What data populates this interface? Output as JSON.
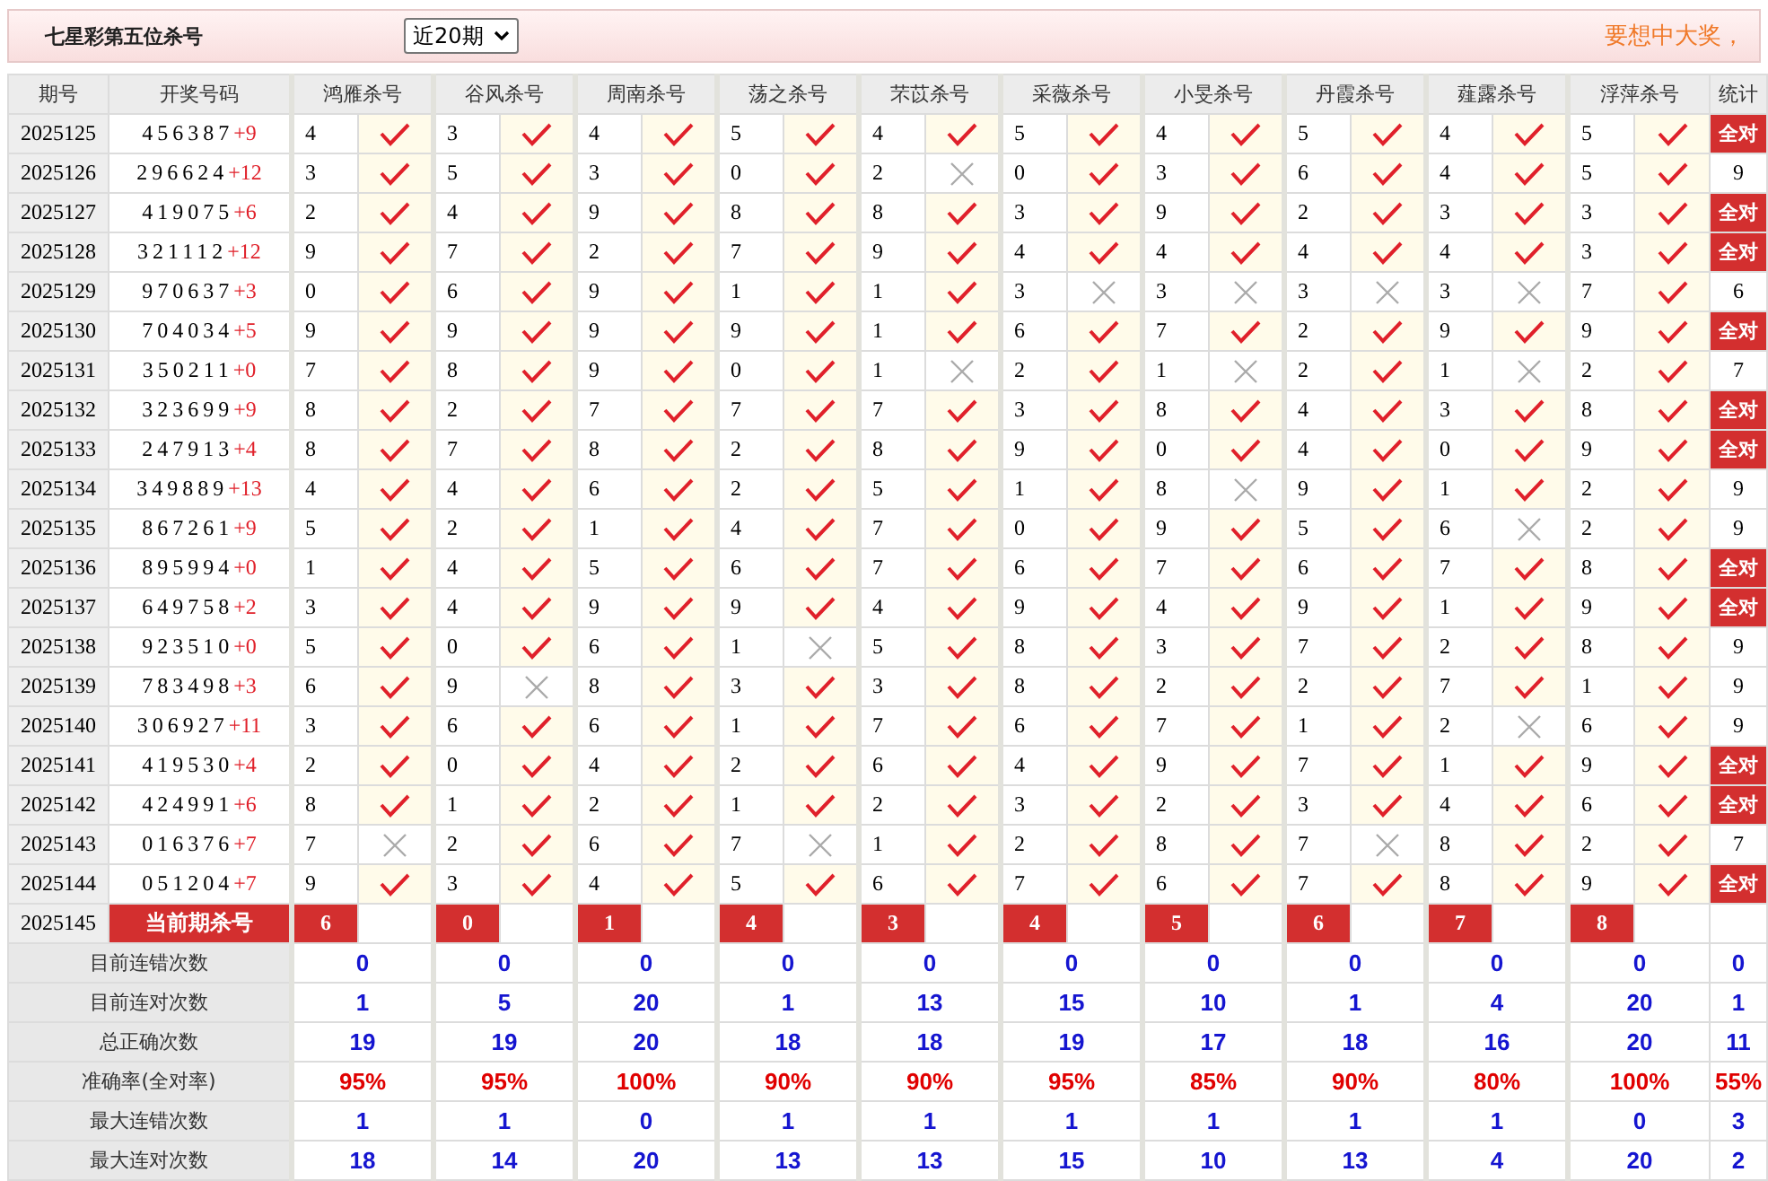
{
  "header": {
    "title": "七星彩第五位杀号",
    "period_select": "近20期",
    "slogan": "要想中大奖，"
  },
  "table": {
    "columns": [
      "期号",
      "开奖号码",
      "鸿雁杀号",
      "谷风杀号",
      "周南杀号",
      "荡之杀号",
      "芣苡杀号",
      "采薇杀号",
      "小旻杀号",
      "丹霞杀号",
      "薤露杀号",
      "浮萍杀号",
      "统计"
    ],
    "rows": [
      {
        "issue": "2025125",
        "draw": "456387",
        "extra": "+9",
        "picks": [
          {
            "number": "4",
            "hit": true
          },
          {
            "number": "3",
            "hit": true
          },
          {
            "number": "4",
            "hit": true
          },
          {
            "number": "5",
            "hit": true
          },
          {
            "number": "4",
            "hit": true
          },
          {
            "number": "5",
            "hit": true
          },
          {
            "number": "4",
            "hit": true
          },
          {
            "number": "5",
            "hit": true
          },
          {
            "number": "4",
            "hit": true
          },
          {
            "number": "5",
            "hit": true
          }
        ],
        "stat": {
          "kind": "badge",
          "text": "全对"
        }
      },
      {
        "issue": "2025126",
        "draw": "296624",
        "extra": "+12",
        "picks": [
          {
            "number": "3",
            "hit": true
          },
          {
            "number": "5",
            "hit": true
          },
          {
            "number": "3",
            "hit": true
          },
          {
            "number": "0",
            "hit": true
          },
          {
            "number": "2",
            "hit": false
          },
          {
            "number": "0",
            "hit": true
          },
          {
            "number": "3",
            "hit": true
          },
          {
            "number": "6",
            "hit": true
          },
          {
            "number": "4",
            "hit": true
          },
          {
            "number": "5",
            "hit": true
          }
        ],
        "stat": {
          "kind": "plain",
          "text": "9"
        }
      },
      {
        "issue": "2025127",
        "draw": "419075",
        "extra": "+6",
        "picks": [
          {
            "number": "2",
            "hit": true
          },
          {
            "number": "4",
            "hit": true
          },
          {
            "number": "9",
            "hit": true
          },
          {
            "number": "8",
            "hit": true
          },
          {
            "number": "8",
            "hit": true
          },
          {
            "number": "3",
            "hit": true
          },
          {
            "number": "9",
            "hit": true
          },
          {
            "number": "2",
            "hit": true
          },
          {
            "number": "3",
            "hit": true
          },
          {
            "number": "3",
            "hit": true
          }
        ],
        "stat": {
          "kind": "badge",
          "text": "全对"
        }
      },
      {
        "issue": "2025128",
        "draw": "321112",
        "extra": "+12",
        "picks": [
          {
            "number": "9",
            "hit": true
          },
          {
            "number": "7",
            "hit": true
          },
          {
            "number": "2",
            "hit": true
          },
          {
            "number": "7",
            "hit": true
          },
          {
            "number": "9",
            "hit": true
          },
          {
            "number": "4",
            "hit": true
          },
          {
            "number": "4",
            "hit": true
          },
          {
            "number": "4",
            "hit": true
          },
          {
            "number": "4",
            "hit": true
          },
          {
            "number": "3",
            "hit": true
          }
        ],
        "stat": {
          "kind": "badge",
          "text": "全对"
        }
      },
      {
        "issue": "2025129",
        "draw": "970637",
        "extra": "+3",
        "picks": [
          {
            "number": "0",
            "hit": true
          },
          {
            "number": "6",
            "hit": true
          },
          {
            "number": "9",
            "hit": true
          },
          {
            "number": "1",
            "hit": true
          },
          {
            "number": "1",
            "hit": true
          },
          {
            "number": "3",
            "hit": false
          },
          {
            "number": "3",
            "hit": false
          },
          {
            "number": "3",
            "hit": false
          },
          {
            "number": "3",
            "hit": false
          },
          {
            "number": "7",
            "hit": true
          }
        ],
        "stat": {
          "kind": "plain",
          "text": "6"
        }
      },
      {
        "issue": "2025130",
        "draw": "704034",
        "extra": "+5",
        "picks": [
          {
            "number": "9",
            "hit": true
          },
          {
            "number": "9",
            "hit": true
          },
          {
            "number": "9",
            "hit": true
          },
          {
            "number": "9",
            "hit": true
          },
          {
            "number": "1",
            "hit": true
          },
          {
            "number": "6",
            "hit": true
          },
          {
            "number": "7",
            "hit": true
          },
          {
            "number": "2",
            "hit": true
          },
          {
            "number": "9",
            "hit": true
          },
          {
            "number": "9",
            "hit": true
          }
        ],
        "stat": {
          "kind": "badge",
          "text": "全对"
        }
      },
      {
        "issue": "2025131",
        "draw": "350211",
        "extra": "+0",
        "picks": [
          {
            "number": "7",
            "hit": true
          },
          {
            "number": "8",
            "hit": true
          },
          {
            "number": "9",
            "hit": true
          },
          {
            "number": "0",
            "hit": true
          },
          {
            "number": "1",
            "hit": false
          },
          {
            "number": "2",
            "hit": true
          },
          {
            "number": "1",
            "hit": false
          },
          {
            "number": "2",
            "hit": true
          },
          {
            "number": "1",
            "hit": false
          },
          {
            "number": "2",
            "hit": true
          }
        ],
        "stat": {
          "kind": "plain",
          "text": "7"
        }
      },
      {
        "issue": "2025132",
        "draw": "323699",
        "extra": "+9",
        "picks": [
          {
            "number": "8",
            "hit": true
          },
          {
            "number": "2",
            "hit": true
          },
          {
            "number": "7",
            "hit": true
          },
          {
            "number": "7",
            "hit": true
          },
          {
            "number": "7",
            "hit": true
          },
          {
            "number": "3",
            "hit": true
          },
          {
            "number": "8",
            "hit": true
          },
          {
            "number": "4",
            "hit": true
          },
          {
            "number": "3",
            "hit": true
          },
          {
            "number": "8",
            "hit": true
          }
        ],
        "stat": {
          "kind": "badge",
          "text": "全对"
        }
      },
      {
        "issue": "2025133",
        "draw": "247913",
        "extra": "+4",
        "picks": [
          {
            "number": "8",
            "hit": true
          },
          {
            "number": "7",
            "hit": true
          },
          {
            "number": "8",
            "hit": true
          },
          {
            "number": "2",
            "hit": true
          },
          {
            "number": "8",
            "hit": true
          },
          {
            "number": "9",
            "hit": true
          },
          {
            "number": "0",
            "hit": true
          },
          {
            "number": "4",
            "hit": true
          },
          {
            "number": "0",
            "hit": true
          },
          {
            "number": "9",
            "hit": true
          }
        ],
        "stat": {
          "kind": "badge",
          "text": "全对"
        }
      },
      {
        "issue": "2025134",
        "draw": "349889",
        "extra": "+13",
        "picks": [
          {
            "number": "4",
            "hit": true
          },
          {
            "number": "4",
            "hit": true
          },
          {
            "number": "6",
            "hit": true
          },
          {
            "number": "2",
            "hit": true
          },
          {
            "number": "5",
            "hit": true
          },
          {
            "number": "1",
            "hit": true
          },
          {
            "number": "8",
            "hit": false
          },
          {
            "number": "9",
            "hit": true
          },
          {
            "number": "1",
            "hit": true
          },
          {
            "number": "2",
            "hit": true
          }
        ],
        "stat": {
          "kind": "plain",
          "text": "9"
        }
      },
      {
        "issue": "2025135",
        "draw": "867261",
        "extra": "+9",
        "picks": [
          {
            "number": "5",
            "hit": true
          },
          {
            "number": "2",
            "hit": true
          },
          {
            "number": "1",
            "hit": true
          },
          {
            "number": "4",
            "hit": true
          },
          {
            "number": "7",
            "hit": true
          },
          {
            "number": "0",
            "hit": true
          },
          {
            "number": "9",
            "hit": true
          },
          {
            "number": "5",
            "hit": true
          },
          {
            "number": "6",
            "hit": false
          },
          {
            "number": "2",
            "hit": true
          }
        ],
        "stat": {
          "kind": "plain",
          "text": "9"
        }
      },
      {
        "issue": "2025136",
        "draw": "895994",
        "extra": "+0",
        "picks": [
          {
            "number": "1",
            "hit": true
          },
          {
            "number": "4",
            "hit": true
          },
          {
            "number": "5",
            "hit": true
          },
          {
            "number": "6",
            "hit": true
          },
          {
            "number": "7",
            "hit": true
          },
          {
            "number": "6",
            "hit": true
          },
          {
            "number": "7",
            "hit": true
          },
          {
            "number": "6",
            "hit": true
          },
          {
            "number": "7",
            "hit": true
          },
          {
            "number": "8",
            "hit": true
          }
        ],
        "stat": {
          "kind": "badge",
          "text": "全对"
        }
      },
      {
        "issue": "2025137",
        "draw": "649758",
        "extra": "+2",
        "picks": [
          {
            "number": "3",
            "hit": true
          },
          {
            "number": "4",
            "hit": true
          },
          {
            "number": "9",
            "hit": true
          },
          {
            "number": "9",
            "hit": true
          },
          {
            "number": "4",
            "hit": true
          },
          {
            "number": "9",
            "hit": true
          },
          {
            "number": "4",
            "hit": true
          },
          {
            "number": "9",
            "hit": true
          },
          {
            "number": "1",
            "hit": true
          },
          {
            "number": "9",
            "hit": true
          }
        ],
        "stat": {
          "kind": "badge",
          "text": "全对"
        }
      },
      {
        "issue": "2025138",
        "draw": "923510",
        "extra": "+0",
        "picks": [
          {
            "number": "5",
            "hit": true
          },
          {
            "number": "0",
            "hit": true
          },
          {
            "number": "6",
            "hit": true
          },
          {
            "number": "1",
            "hit": false
          },
          {
            "number": "5",
            "hit": true
          },
          {
            "number": "8",
            "hit": true
          },
          {
            "number": "3",
            "hit": true
          },
          {
            "number": "7",
            "hit": true
          },
          {
            "number": "2",
            "hit": true
          },
          {
            "number": "8",
            "hit": true
          }
        ],
        "stat": {
          "kind": "plain",
          "text": "9"
        }
      },
      {
        "issue": "2025139",
        "draw": "783498",
        "extra": "+3",
        "picks": [
          {
            "number": "6",
            "hit": true
          },
          {
            "number": "9",
            "hit": false
          },
          {
            "number": "8",
            "hit": true
          },
          {
            "number": "3",
            "hit": true
          },
          {
            "number": "3",
            "hit": true
          },
          {
            "number": "8",
            "hit": true
          },
          {
            "number": "2",
            "hit": true
          },
          {
            "number": "2",
            "hit": true
          },
          {
            "number": "7",
            "hit": true
          },
          {
            "number": "1",
            "hit": true
          }
        ],
        "stat": {
          "kind": "plain",
          "text": "9"
        }
      },
      {
        "issue": "2025140",
        "draw": "306927",
        "extra": "+11",
        "picks": [
          {
            "number": "3",
            "hit": true
          },
          {
            "number": "6",
            "hit": true
          },
          {
            "number": "6",
            "hit": true
          },
          {
            "number": "1",
            "hit": true
          },
          {
            "number": "7",
            "hit": true
          },
          {
            "number": "6",
            "hit": true
          },
          {
            "number": "7",
            "hit": true
          },
          {
            "number": "1",
            "hit": true
          },
          {
            "number": "2",
            "hit": false
          },
          {
            "number": "6",
            "hit": true
          }
        ],
        "stat": {
          "kind": "plain",
          "text": "9"
        }
      },
      {
        "issue": "2025141",
        "draw": "419530",
        "extra": "+4",
        "picks": [
          {
            "number": "2",
            "hit": true
          },
          {
            "number": "0",
            "hit": true
          },
          {
            "number": "4",
            "hit": true
          },
          {
            "number": "2",
            "hit": true
          },
          {
            "number": "6",
            "hit": true
          },
          {
            "number": "4",
            "hit": true
          },
          {
            "number": "9",
            "hit": true
          },
          {
            "number": "7",
            "hit": true
          },
          {
            "number": "1",
            "hit": true
          },
          {
            "number": "9",
            "hit": true
          }
        ],
        "stat": {
          "kind": "badge",
          "text": "全对"
        }
      },
      {
        "issue": "2025142",
        "draw": "424991",
        "extra": "+6",
        "picks": [
          {
            "number": "8",
            "hit": true
          },
          {
            "number": "1",
            "hit": true
          },
          {
            "number": "2",
            "hit": true
          },
          {
            "number": "1",
            "hit": true
          },
          {
            "number": "2",
            "hit": true
          },
          {
            "number": "3",
            "hit": true
          },
          {
            "number": "2",
            "hit": true
          },
          {
            "number": "3",
            "hit": true
          },
          {
            "number": "4",
            "hit": true
          },
          {
            "number": "6",
            "hit": true
          }
        ],
        "stat": {
          "kind": "badge",
          "text": "全对"
        }
      },
      {
        "issue": "2025143",
        "draw": "016376",
        "extra": "+7",
        "picks": [
          {
            "number": "7",
            "hit": false
          },
          {
            "number": "2",
            "hit": true
          },
          {
            "number": "6",
            "hit": true
          },
          {
            "number": "7",
            "hit": false
          },
          {
            "number": "1",
            "hit": true
          },
          {
            "number": "2",
            "hit": true
          },
          {
            "number": "8",
            "hit": true
          },
          {
            "number": "7",
            "hit": false
          },
          {
            "number": "8",
            "hit": true
          },
          {
            "number": "2",
            "hit": true
          }
        ],
        "stat": {
          "kind": "plain",
          "text": "7"
        }
      },
      {
        "issue": "2025144",
        "draw": "051204",
        "extra": "+7",
        "picks": [
          {
            "number": "9",
            "hit": true
          },
          {
            "number": "3",
            "hit": true
          },
          {
            "number": "4",
            "hit": true
          },
          {
            "number": "5",
            "hit": true
          },
          {
            "number": "6",
            "hit": true
          },
          {
            "number": "7",
            "hit": true
          },
          {
            "number": "6",
            "hit": true
          },
          {
            "number": "7",
            "hit": true
          },
          {
            "number": "8",
            "hit": true
          },
          {
            "number": "9",
            "hit": true
          }
        ],
        "stat": {
          "kind": "badge",
          "text": "全对"
        }
      }
    ],
    "current": {
      "issue": "2025145",
      "label": "当前期杀号",
      "kills": [
        "6",
        "0",
        "1",
        "4",
        "3",
        "4",
        "5",
        "6",
        "7",
        "8"
      ]
    },
    "stats": [
      {
        "label": "目前连错次数",
        "kind": "count",
        "values": [
          "0",
          "0",
          "0",
          "0",
          "0",
          "0",
          "0",
          "0",
          "0",
          "0",
          "0"
        ]
      },
      {
        "label": "目前连对次数",
        "kind": "count",
        "values": [
          "1",
          "5",
          "20",
          "1",
          "13",
          "15",
          "10",
          "1",
          "4",
          "20",
          "1"
        ]
      },
      {
        "label": "总正确次数",
        "kind": "count",
        "values": [
          "19",
          "19",
          "20",
          "18",
          "18",
          "19",
          "17",
          "18",
          "16",
          "20",
          "11"
        ]
      },
      {
        "label": "准确率(全对率)",
        "kind": "rate",
        "values": [
          "95%",
          "95%",
          "100%",
          "90%",
          "90%",
          "95%",
          "85%",
          "90%",
          "80%",
          "100%",
          "55%"
        ]
      },
      {
        "label": "最大连错次数",
        "kind": "count",
        "values": [
          "1",
          "1",
          "0",
          "1",
          "1",
          "1",
          "1",
          "1",
          "1",
          "0",
          "3"
        ]
      },
      {
        "label": "最大连对次数",
        "kind": "count",
        "values": [
          "18",
          "14",
          "20",
          "13",
          "13",
          "15",
          "10",
          "13",
          "4",
          "20",
          "2"
        ]
      }
    ]
  }
}
